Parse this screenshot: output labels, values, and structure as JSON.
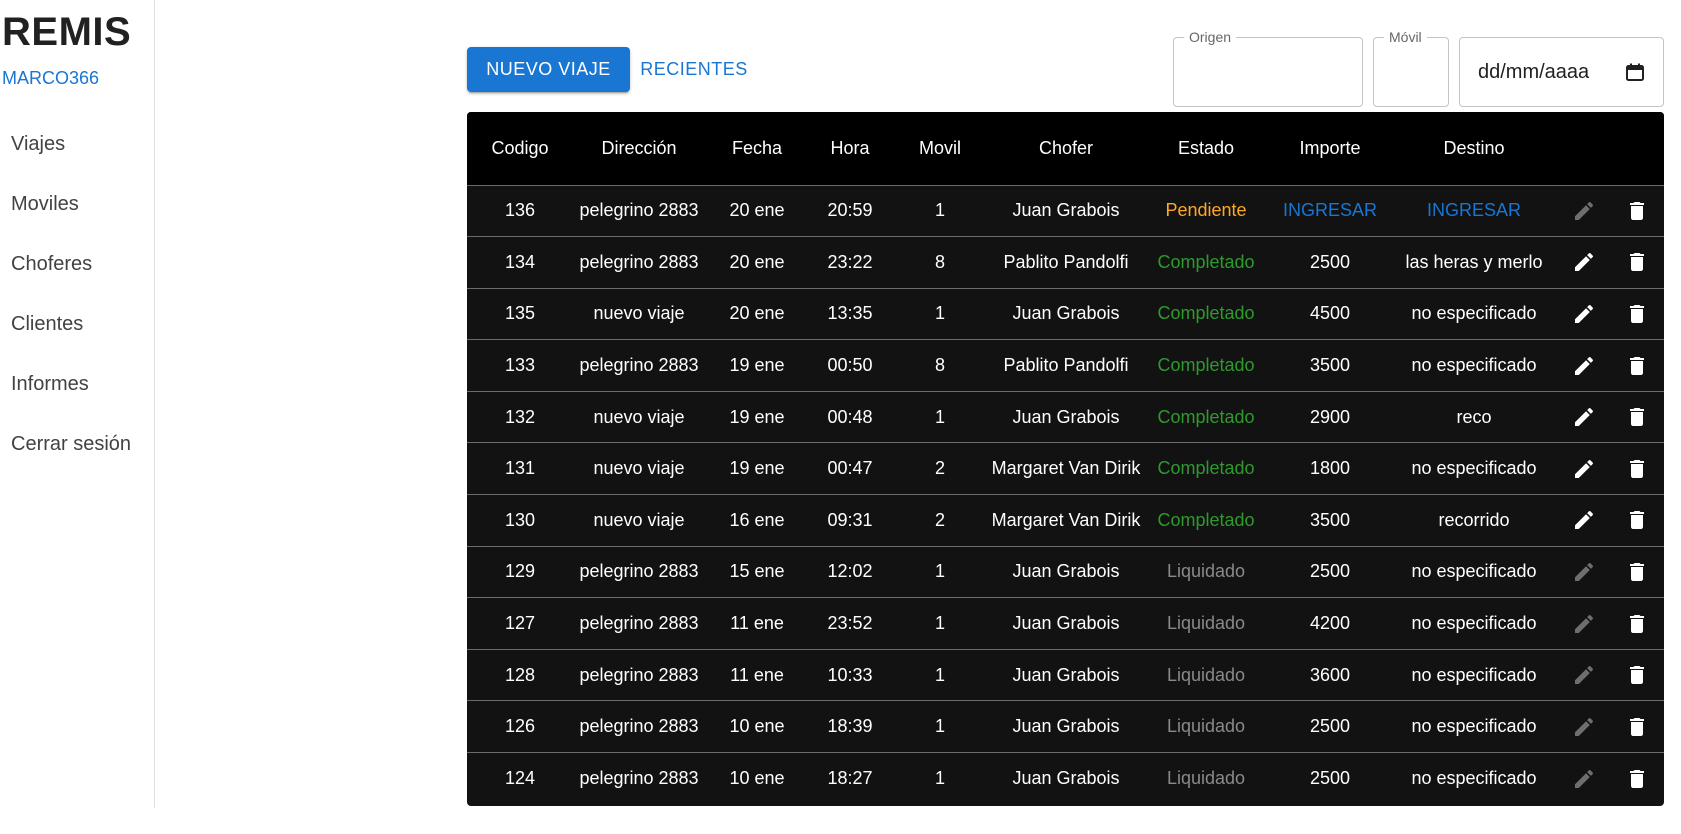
{
  "sidebar": {
    "brand": "REMIS",
    "user": "MARCO366",
    "items": [
      {
        "label": "Viajes"
      },
      {
        "label": "Moviles"
      },
      {
        "label": "Choferes"
      },
      {
        "label": "Clientes"
      },
      {
        "label": "Informes"
      },
      {
        "label": "Cerrar sesión"
      }
    ]
  },
  "toolbar": {
    "new_trip_label": "NUEVO VIAJE",
    "recent_label": "RECIENTES"
  },
  "filters": {
    "origen_label": "Origen",
    "origen_value": "",
    "movil_label": "Móvil",
    "movil_value": "",
    "date_placeholder": "dd/mm/aaaa"
  },
  "colors": {
    "accent": "#1976d2",
    "pendiente": "#ffa726",
    "completado": "#2e9a2e",
    "liquidado": "#8a8a8a",
    "table_bg": "#121212"
  },
  "table": {
    "columns": [
      "Codigo",
      "Dirección",
      "Fecha",
      "Hora",
      "Movil",
      "Chofer",
      "Estado",
      "Importe",
      "Destino"
    ],
    "rows": [
      {
        "codigo": "136",
        "direccion": "pelegrino 2883",
        "fecha": "20 ene",
        "hora": "20:59",
        "movil": "1",
        "chofer": "Juan Grabois",
        "estado": "Pendiente",
        "importe": "INGRESAR",
        "destino": "INGRESAR",
        "edit_enabled": false
      },
      {
        "codigo": "134",
        "direccion": "pelegrino 2883",
        "fecha": "20 ene",
        "hora": "23:22",
        "movil": "8",
        "chofer": "Pablito Pandolfi",
        "estado": "Completado",
        "importe": "2500",
        "destino": "las heras y merlo",
        "edit_enabled": true
      },
      {
        "codigo": "135",
        "direccion": "nuevo viaje",
        "fecha": "20 ene",
        "hora": "13:35",
        "movil": "1",
        "chofer": "Juan Grabois",
        "estado": "Completado",
        "importe": "4500",
        "destino": "no especificado",
        "edit_enabled": true
      },
      {
        "codigo": "133",
        "direccion": "pelegrino 2883",
        "fecha": "19 ene",
        "hora": "00:50",
        "movil": "8",
        "chofer": "Pablito Pandolfi",
        "estado": "Completado",
        "importe": "3500",
        "destino": "no especificado",
        "edit_enabled": true
      },
      {
        "codigo": "132",
        "direccion": "nuevo viaje",
        "fecha": "19 ene",
        "hora": "00:48",
        "movil": "1",
        "chofer": "Juan Grabois",
        "estado": "Completado",
        "importe": "2900",
        "destino": "reco",
        "edit_enabled": true
      },
      {
        "codigo": "131",
        "direccion": "nuevo viaje",
        "fecha": "19 ene",
        "hora": "00:47",
        "movil": "2",
        "chofer": "Margaret Van Dirik",
        "estado": "Completado",
        "importe": "1800",
        "destino": "no especificado",
        "edit_enabled": true
      },
      {
        "codigo": "130",
        "direccion": "nuevo viaje",
        "fecha": "16 ene",
        "hora": "09:31",
        "movil": "2",
        "chofer": "Margaret Van Dirik",
        "estado": "Completado",
        "importe": "3500",
        "destino": "recorrido",
        "edit_enabled": true
      },
      {
        "codigo": "129",
        "direccion": "pelegrino 2883",
        "fecha": "15 ene",
        "hora": "12:02",
        "movil": "1",
        "chofer": "Juan Grabois",
        "estado": "Liquidado",
        "importe": "2500",
        "destino": "no especificado",
        "edit_enabled": false
      },
      {
        "codigo": "127",
        "direccion": "pelegrino 2883",
        "fecha": "11 ene",
        "hora": "23:52",
        "movil": "1",
        "chofer": "Juan Grabois",
        "estado": "Liquidado",
        "importe": "4200",
        "destino": "no especificado",
        "edit_enabled": false
      },
      {
        "codigo": "128",
        "direccion": "pelegrino 2883",
        "fecha": "11 ene",
        "hora": "10:33",
        "movil": "1",
        "chofer": "Juan Grabois",
        "estado": "Liquidado",
        "importe": "3600",
        "destino": "no especificado",
        "edit_enabled": false
      },
      {
        "codigo": "126",
        "direccion": "pelegrino 2883",
        "fecha": "10 ene",
        "hora": "18:39",
        "movil": "1",
        "chofer": "Juan Grabois",
        "estado": "Liquidado",
        "importe": "2500",
        "destino": "no especificado",
        "edit_enabled": false
      },
      {
        "codigo": "124",
        "direccion": "pelegrino 2883",
        "fecha": "10 ene",
        "hora": "18:27",
        "movil": "1",
        "chofer": "Juan Grabois",
        "estado": "Liquidado",
        "importe": "2500",
        "destino": "no especificado",
        "edit_enabled": false
      }
    ]
  }
}
